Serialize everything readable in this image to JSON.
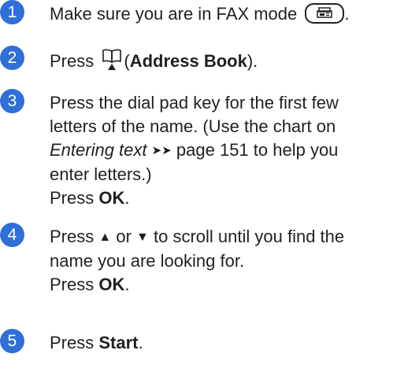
{
  "steps": [
    {
      "number": "1",
      "text_before": "Make sure you are in FAX mode",
      "mode_key_icon": "fax-icon",
      "text_after": "."
    },
    {
      "number": "2",
      "press": "Press",
      "icon": "address-book-icon",
      "paren_open": "(",
      "bold": "Address Book",
      "paren_close": ")."
    },
    {
      "number": "3",
      "line1": "Press the dial pad key for the first few",
      "line2": "letters of the name. (Use the chart on",
      "italic": "Entering text",
      "page_ref": "page 151 to help you",
      "line4": "enter letters.)",
      "press": "Press",
      "ok": "OK",
      "period": "."
    },
    {
      "number": "4",
      "press": "Press",
      "up_arrow": "▲",
      "or": "or",
      "down_arrow": "▼",
      "line1_rest": "to scroll until you find the",
      "line2": "name you are looking for.",
      "press2": "Press",
      "ok": "OK",
      "period": "."
    },
    {
      "number": "5",
      "press": "Press",
      "bold": "Start",
      "period": "."
    }
  ],
  "accent_color": "#2f6fd6",
  "text_color": "#231f20"
}
